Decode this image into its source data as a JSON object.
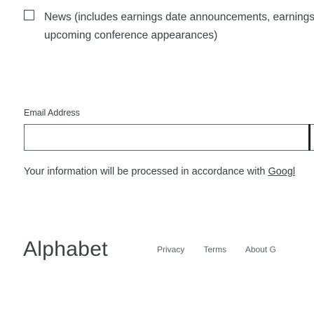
{
  "consent": {
    "label_line1": "News (includes earnings date announcements, earnings",
    "label_line2": "upcoming conference appearances)",
    "checked": false
  },
  "email": {
    "label": "Email Address",
    "value": "",
    "placeholder": ""
  },
  "privacy": {
    "text": "Your information will be processed in accordance with ",
    "link_text": "Googl"
  },
  "footer": {
    "logo": "Alphabet",
    "links": [
      "Privacy",
      "Terms",
      "About G"
    ]
  }
}
